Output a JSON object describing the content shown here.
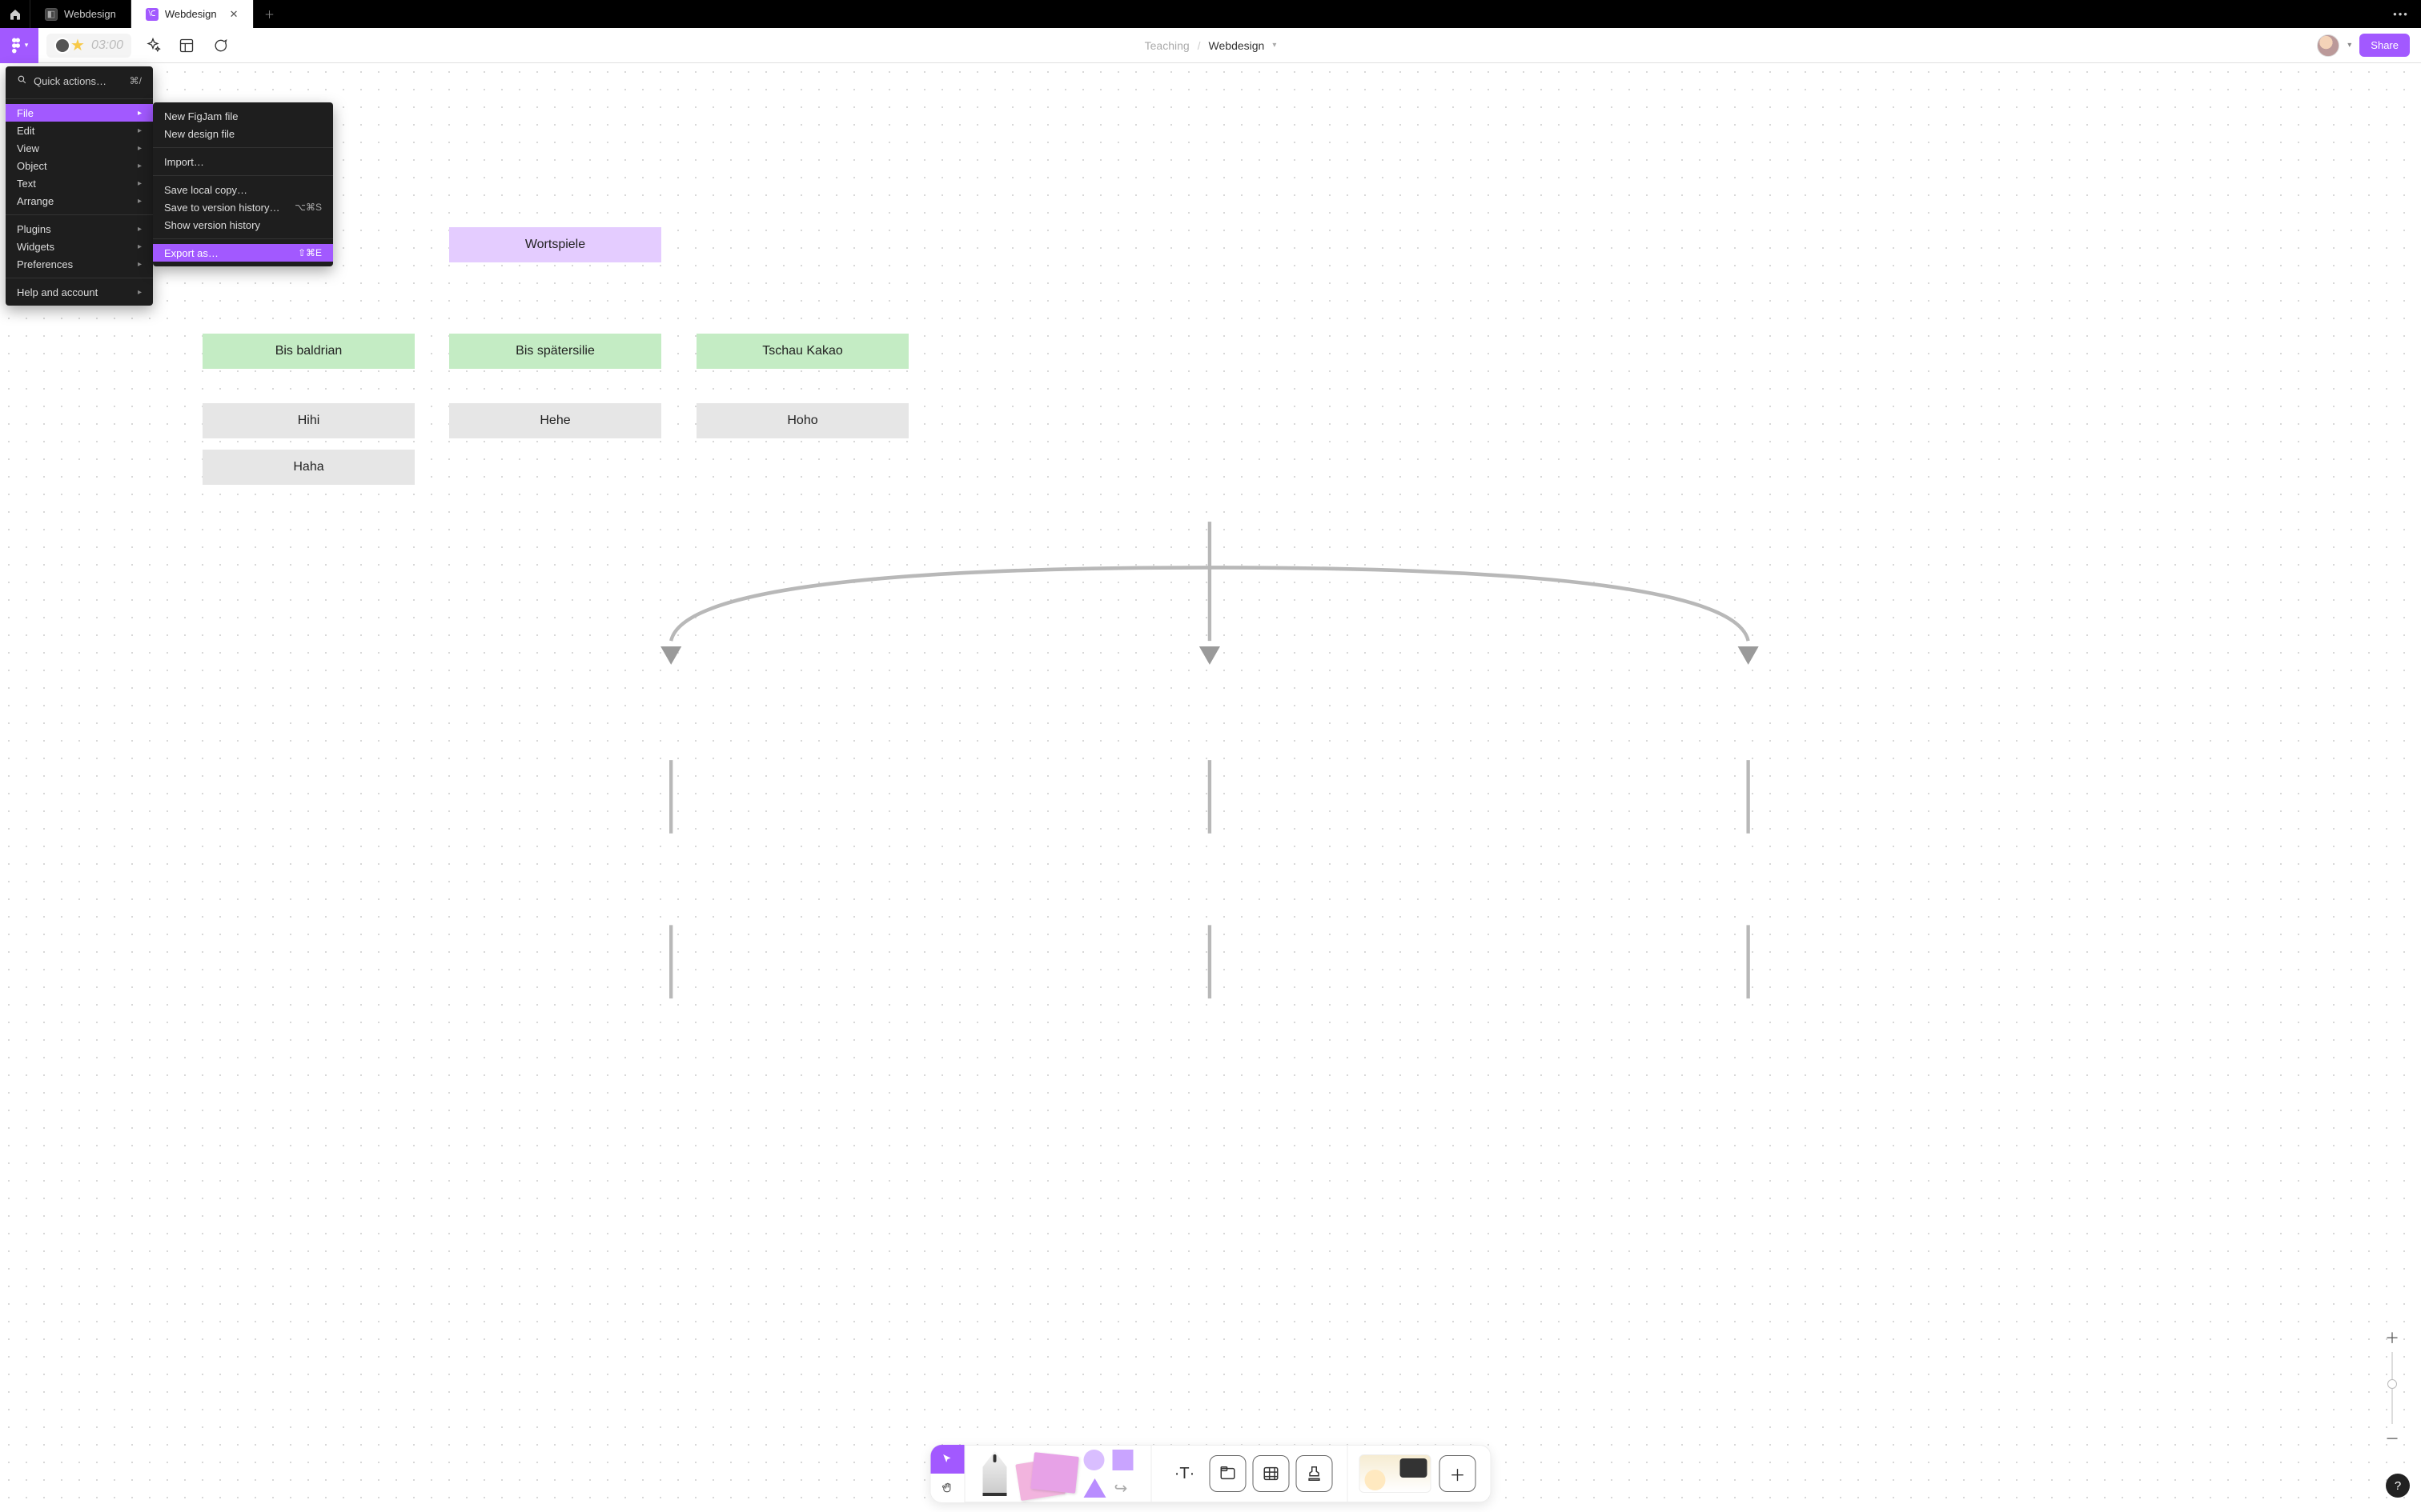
{
  "tabs": {
    "inactive_label": "Webdesign",
    "active_label": "Webdesign"
  },
  "toolbar": {
    "timer_text": "03:00",
    "crumb_root": "Teaching",
    "crumb_name": "Webdesign",
    "share_label": "Share"
  },
  "menu": {
    "quick_actions_label": "Quick actions…",
    "quick_actions_kbd": "⌘/",
    "items": [
      {
        "label": "File",
        "active": true
      },
      {
        "label": "Edit",
        "active": false
      },
      {
        "label": "View",
        "active": false
      },
      {
        "label": "Object",
        "active": false
      },
      {
        "label": "Text",
        "active": false
      },
      {
        "label": "Arrange",
        "active": false
      }
    ],
    "items2": [
      {
        "label": "Plugins",
        "active": false
      },
      {
        "label": "Widgets",
        "active": false
      },
      {
        "label": "Preferences",
        "active": false
      }
    ],
    "items3": [
      {
        "label": "Help and account",
        "active": false
      }
    ]
  },
  "submenu": {
    "g1": [
      {
        "label": "New FigJam file",
        "kbd": "",
        "active": false
      },
      {
        "label": "New design file",
        "kbd": "",
        "active": false
      }
    ],
    "g2": [
      {
        "label": "Import…",
        "kbd": "",
        "active": false
      }
    ],
    "g3": [
      {
        "label": "Save local copy…",
        "kbd": "",
        "active": false
      },
      {
        "label": "Save to version history…",
        "kbd": "⌥⌘S",
        "active": false
      },
      {
        "label": "Show version history",
        "kbd": "",
        "active": false
      }
    ],
    "g4": [
      {
        "label": "Export as…",
        "kbd": "⇧⌘E",
        "active": true
      }
    ]
  },
  "nodes": {
    "root": "Wortspiele",
    "a": "Bis baldrian",
    "b": "Bis spätersilie",
    "c": "Tschau Kakao",
    "a1": "Hihi",
    "b1": "Hehe",
    "c1": "Hoho",
    "a2": "Haha"
  },
  "help_label": "?",
  "colors": {
    "brand": "#a259ff"
  }
}
